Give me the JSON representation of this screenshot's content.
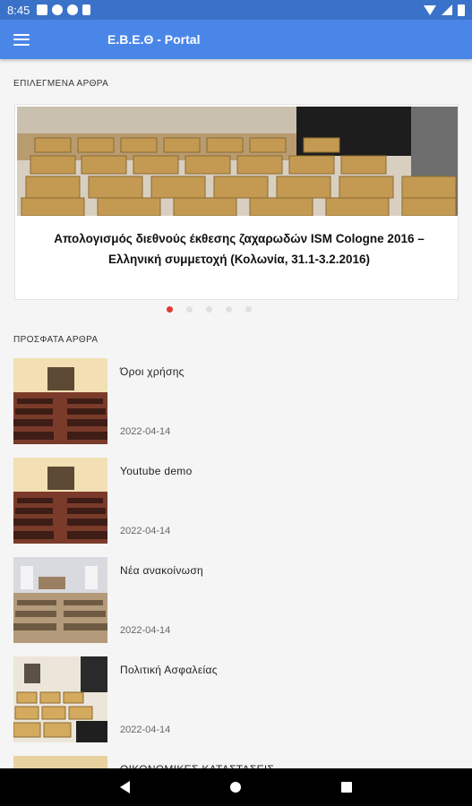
{
  "status_bar": {
    "time": "8:45",
    "icons": [
      "notification-a-icon",
      "notification-p-icon",
      "notification-round-icon",
      "sd-card-icon",
      "wifi-icon",
      "signal-icon",
      "battery-icon"
    ]
  },
  "app_bar": {
    "title": "Ε.Β.Ε.Θ - Portal",
    "menu_icon": "hamburger-menu-icon"
  },
  "featured": {
    "section_label": "ΕΠΙΛΕΓΜΕΝΑ ΑΡΘΡΑ",
    "title": "Απολογισμός διεθνούς έκθεσης ζαχαρωδών ISM Cologne 2016 – Ελληνική συμμετοχή  (Κολωνία, 31.1-3.2.2016)",
    "dots_count": 5,
    "active_dot": 0
  },
  "recent": {
    "section_label": "ΠΡΟΣΦΑΤΑ ΑΡΘΡΑ",
    "articles": [
      {
        "title": "Όροι χρήσης",
        "date": "2022-04-14"
      },
      {
        "title": "Youtube demo",
        "date": "2022-04-14"
      },
      {
        "title": "Νέα ανακοίνωση",
        "date": "2022-04-14"
      },
      {
        "title": "Πολιτική Ασφαλείας",
        "date": "2022-04-14"
      },
      {
        "title": "ΟΙΚΟΝΟΜΙΚΕΣ ΚΑΤΑΣΤΑΣΕΙΣ",
        "date": ""
      }
    ]
  },
  "colors": {
    "status_bar": "#3a72c9",
    "app_bar": "#4a86e8",
    "active_dot": "#e53935"
  },
  "nav_bar": {
    "icons": [
      "back-icon",
      "home-icon",
      "recents-icon"
    ]
  }
}
